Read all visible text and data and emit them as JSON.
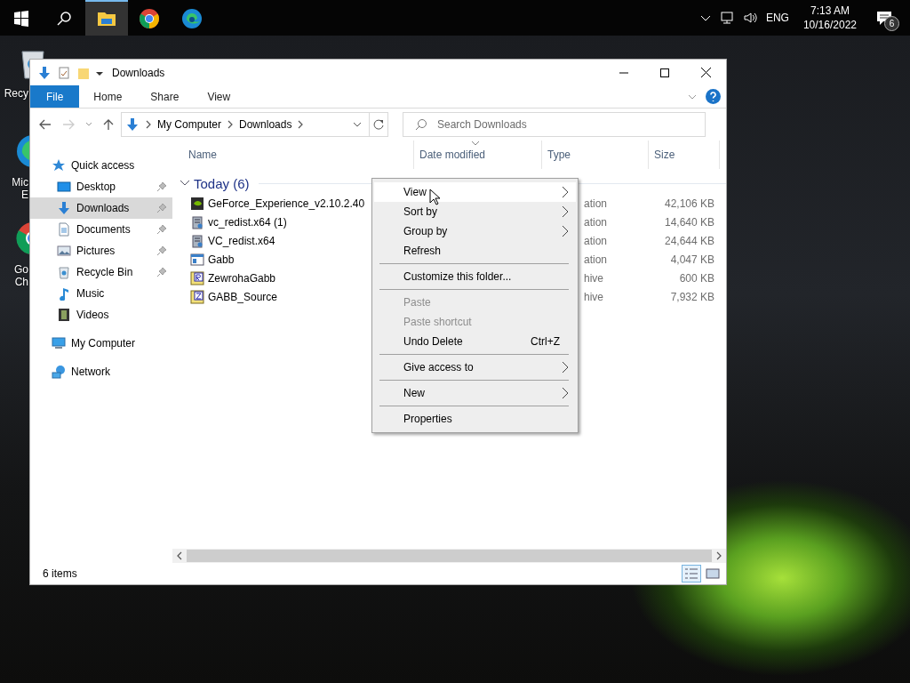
{
  "taskbar": {
    "apps": [
      {
        "kind": "explorer",
        "selected": true
      },
      {
        "kind": "chrome",
        "selected": false
      },
      {
        "kind": "edge",
        "selected": false
      }
    ],
    "language": "ENG",
    "clock_time": "7:13 AM",
    "clock_date": "10/16/2022",
    "notification_count": "6"
  },
  "desktop_icons": [
    {
      "kind": "recycle",
      "lines": [
        "Recy"
      ]
    },
    {
      "kind": "edge",
      "lines": [
        "Mic",
        "E"
      ]
    },
    {
      "kind": "chrome",
      "lines": [
        "Go",
        "Ch"
      ]
    }
  ],
  "window": {
    "title": "Downloads",
    "ribbon_tabs": [
      {
        "label": "File",
        "selected": true
      },
      {
        "label": "Home",
        "selected": false
      },
      {
        "label": "Share",
        "selected": false
      },
      {
        "label": "View",
        "selected": false
      }
    ],
    "address": {
      "segments": [
        "My Computer",
        "Downloads"
      ]
    },
    "search": {
      "placeholder": "Search Downloads"
    },
    "nav": [
      {
        "label": "Quick access",
        "kind": "star",
        "selected": false,
        "children": [
          {
            "label": "Desktop",
            "kind": "desktop",
            "pinned": true,
            "selected": false
          },
          {
            "label": "Downloads",
            "kind": "download",
            "pinned": true,
            "selected": true
          },
          {
            "label": "Documents",
            "kind": "document",
            "pinned": true,
            "selected": false
          },
          {
            "label": "Pictures",
            "kind": "picture",
            "pinned": true,
            "selected": false
          },
          {
            "label": "Recycle Bin",
            "kind": "recycle",
            "pinned": true,
            "selected": false
          },
          {
            "label": "Music",
            "kind": "music",
            "pinned": false,
            "selected": false
          },
          {
            "label": "Videos",
            "kind": "video",
            "pinned": false,
            "selected": false
          }
        ]
      },
      {
        "label": "My Computer",
        "kind": "computer",
        "selected": false
      },
      {
        "label": "Network",
        "kind": "network",
        "selected": false
      }
    ],
    "columns": [
      {
        "label": "Name",
        "sorted": false
      },
      {
        "label": "Date modified",
        "sorted": true
      },
      {
        "label": "Type",
        "sorted": false
      },
      {
        "label": "Size",
        "sorted": false
      }
    ],
    "group": {
      "label": "Today (6)",
      "expanded": true
    },
    "rows": [
      {
        "name": "GeForce_Experience_v2.10.2.40",
        "kind": "nvidia",
        "type": "ation",
        "size": "42,106 KB"
      },
      {
        "name": "vc_redist.x64 (1)",
        "kind": "installer",
        "type": "ation",
        "size": "14,640 KB"
      },
      {
        "name": "VC_redist.x64",
        "kind": "installer",
        "type": "ation",
        "size": "24,644 KB"
      },
      {
        "name": "Gabb",
        "kind": "app",
        "type": "ation",
        "size": "4,047 KB"
      },
      {
        "name": "ZewrohaGabb",
        "kind": "rar",
        "type": "hive",
        "size": "600 KB"
      },
      {
        "name": "GABB_Source",
        "kind": "zip",
        "type": "hive",
        "size": "7,932 KB"
      }
    ],
    "status": "6 items",
    "view_buttons": [
      {
        "kind": "details",
        "selected": true
      },
      {
        "kind": "large",
        "selected": false
      }
    ]
  },
  "context_menu": [
    {
      "kind": "item",
      "label": "View",
      "submenu": true,
      "disabled": false,
      "selected": true
    },
    {
      "kind": "item",
      "label": "Sort by",
      "submenu": true,
      "disabled": false,
      "selected": false
    },
    {
      "kind": "item",
      "label": "Group by",
      "submenu": true,
      "disabled": false,
      "selected": false
    },
    {
      "kind": "item",
      "label": "Refresh",
      "submenu": false,
      "disabled": false,
      "selected": false
    },
    {
      "kind": "separator"
    },
    {
      "kind": "item",
      "label": "Customize this folder...",
      "submenu": false,
      "disabled": false,
      "selected": false
    },
    {
      "kind": "separator"
    },
    {
      "kind": "item",
      "label": "Paste",
      "submenu": false,
      "disabled": true,
      "selected": false
    },
    {
      "kind": "item",
      "label": "Paste shortcut",
      "submenu": false,
      "disabled": true,
      "selected": false
    },
    {
      "kind": "item",
      "label": "Undo Delete",
      "shortcut": "Ctrl+Z",
      "submenu": false,
      "disabled": false,
      "selected": false
    },
    {
      "kind": "separator"
    },
    {
      "kind": "item",
      "label": "Give access to",
      "submenu": true,
      "disabled": false,
      "selected": false
    },
    {
      "kind": "separator"
    },
    {
      "kind": "item",
      "label": "New",
      "submenu": true,
      "disabled": false,
      "selected": false
    },
    {
      "kind": "separator"
    },
    {
      "kind": "item",
      "label": "Properties",
      "submenu": false,
      "disabled": false,
      "selected": false
    }
  ]
}
